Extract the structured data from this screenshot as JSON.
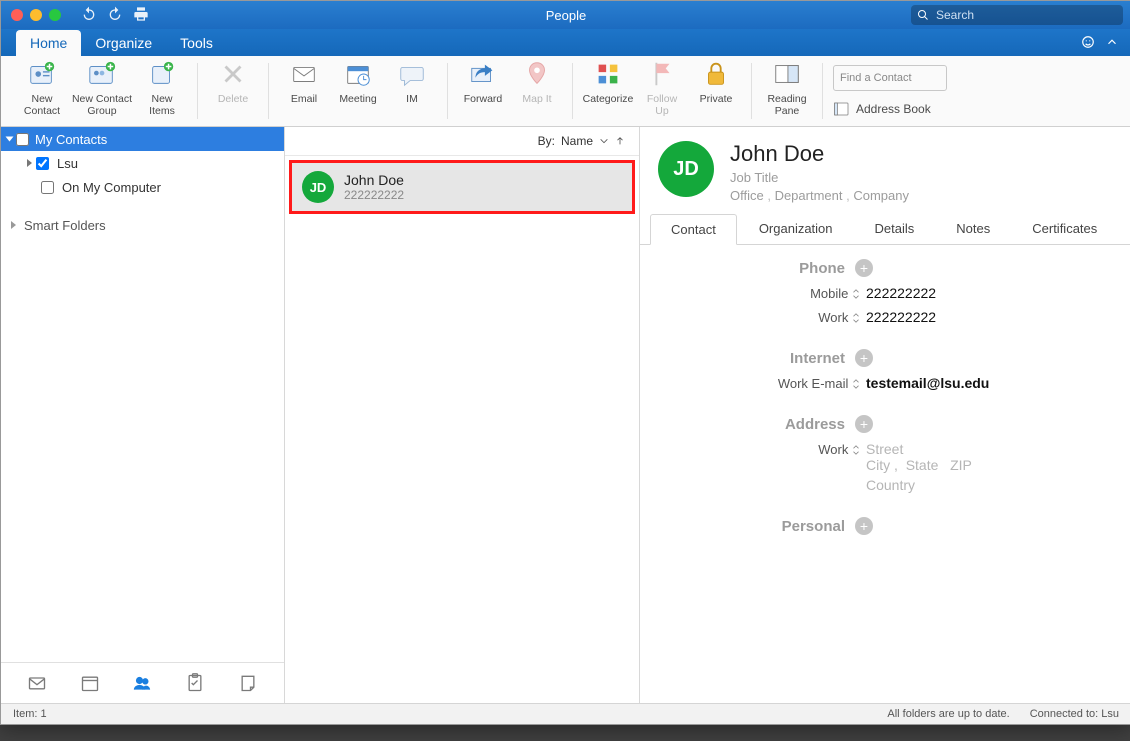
{
  "window": {
    "title": "People",
    "search_placeholder": "Search"
  },
  "tabs": [
    "Home",
    "Organize",
    "Tools"
  ],
  "ribbon": {
    "new_contact": "New\nContact",
    "new_contact_group": "New Contact\nGroup",
    "new_items": "New\nItems",
    "delete": "Delete",
    "email": "Email",
    "meeting": "Meeting",
    "im": "IM",
    "forward": "Forward",
    "map_it": "Map It",
    "categorize": "Categorize",
    "follow_up": "Follow\nUp",
    "private": "Private",
    "reading_pane": "Reading\nPane",
    "find_contact_ph": "Find a Contact",
    "address_book": "Address Book"
  },
  "sidebar": {
    "my_contacts": "My Contacts",
    "items": [
      {
        "label": "Lsu",
        "checked": true
      },
      {
        "label": "On My Computer",
        "checked": false
      }
    ],
    "smart_folders": "Smart Folders"
  },
  "sort": {
    "by_label": "By:",
    "field": "Name"
  },
  "list": [
    {
      "initials": "JD",
      "name": "John Doe",
      "phone": "222222222"
    }
  ],
  "contact": {
    "initials": "JD",
    "name": "John  Doe",
    "job_title": "Job Title",
    "office": "Office",
    "department": "Department",
    "company": "Company",
    "tabs": [
      "Contact",
      "Organization",
      "Details",
      "Notes",
      "Certificates"
    ],
    "sections": {
      "phone": "Phone",
      "mobile_label": "Mobile",
      "mobile": "222222222",
      "work_phone_label": "Work",
      "work_phone": "222222222",
      "internet": "Internet",
      "work_email_label": "Work E-mail",
      "work_email": "testemail@lsu.edu",
      "address": "Address",
      "addr_type": "Work",
      "street": "Street",
      "city": "City",
      "state": "State",
      "zip": "ZIP",
      "country": "Country",
      "personal": "Personal"
    }
  },
  "status": {
    "item_count": "Item: 1",
    "sync": "All folders are up to date.",
    "conn": "Connected to: Lsu"
  }
}
